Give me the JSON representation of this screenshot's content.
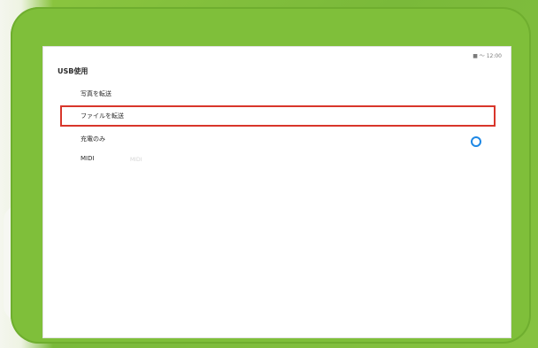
{
  "screen": {
    "status": "■ 〜 12:00",
    "title": "USB使用",
    "options": [
      {
        "label": "写真を転送"
      },
      {
        "label": "ファイルを転送"
      },
      {
        "label": "充電のみ"
      },
      {
        "label": "MIDI"
      }
    ],
    "faint_text": "MIDI"
  },
  "colors": {
    "frame_green": "#7fbf3a",
    "highlight_red": "#d8362b",
    "radio_blue": "#1e88e5"
  }
}
